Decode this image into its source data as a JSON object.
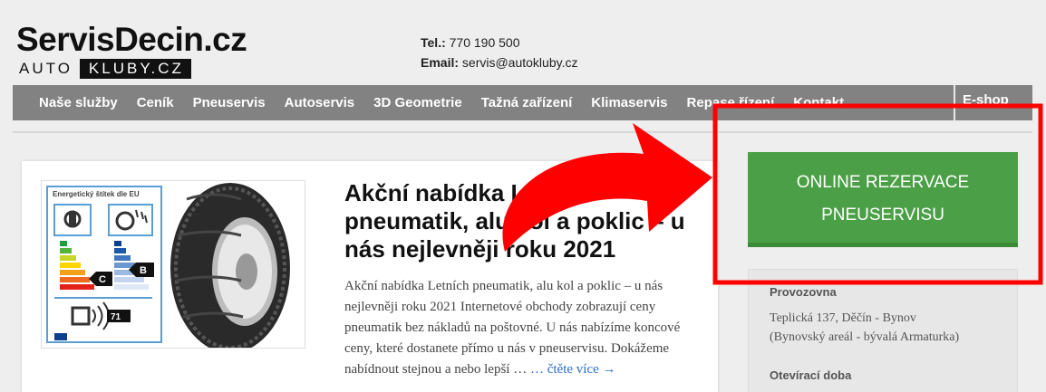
{
  "header": {
    "logo_main": "ServisDecin.cz",
    "logo_auto": "AUTO",
    "logo_kluby": "KLUBY.CZ",
    "phone_label": "Tel.:",
    "phone": "770 190 500",
    "email_label": "Email:",
    "email": "servis@autokluby.cz"
  },
  "nav": {
    "items": [
      "Naše služby",
      "Ceník",
      "Pneuservis",
      "Autoservis",
      "3D Geometrie",
      "Tažná zařízení",
      "Klimaservis",
      "Repase řízení",
      "Kontakt"
    ],
    "eshop": "E-shop"
  },
  "article": {
    "title": "Akční nabídka Letních pneumatik, alu kol a poklic – u nás nejlevněji roku 2021",
    "excerpt": "Akční nabídka Letních pneumatik, alu kol a poklic – u nás nejlevněji roku 2021 Internetové obchody zobrazují ceny pneumatik bez nákladů na poštovné. U nás nabízíme koncové ceny, které dostanete přímo u nás v pneuservisu. Dokážeme nabídnout stejnou a nebo lepší …",
    "read_more": "… čtěte více →",
    "label_title": "Energetický štítek dle EU",
    "label_grade_left": "C",
    "label_grade_right": "B",
    "label_noise": "71"
  },
  "sidebar": {
    "reserve_line1": "ONLINE REZERVACE",
    "reserve_line2": "PNEUSERVISU",
    "branch_heading": "Provozovna",
    "address_line1": "Teplická 137, Děčín - Bynov",
    "address_line2": "(Bynovský areál - bývalá Armaturka)",
    "hours_heading": "Otevírací doba"
  },
  "colors": {
    "nav_bg": "#828282",
    "button_green": "#4b9f47",
    "annotation_red": "#ff0000",
    "link_blue": "#2a6fc9"
  }
}
